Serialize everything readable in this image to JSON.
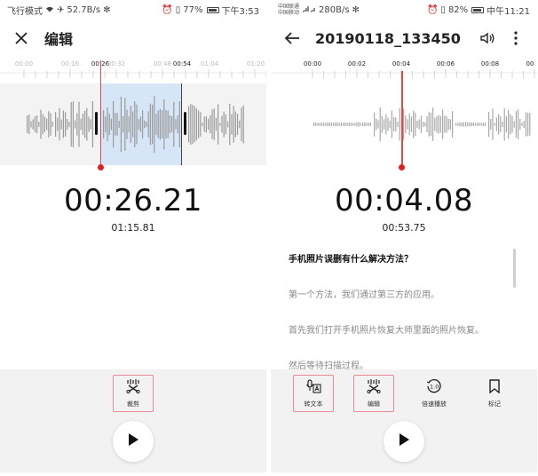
{
  "left": {
    "status": {
      "left_text": "飞行模式",
      "speed": "52.7B/s",
      "battery": "77%",
      "time": "下午3:53"
    },
    "header": {
      "title": "编辑"
    },
    "ruler": {
      "labels": [
        "00:00",
        "00:16",
        "00:26",
        "00:32",
        "00:48",
        "00:54",
        "01:04",
        "01:20"
      ],
      "highlighted": [
        "00:26",
        "00:54"
      ]
    },
    "time_main": "00:26.21",
    "time_sub": "01:15.81",
    "tools": [
      {
        "label": "裁剪",
        "icon": "scissors-waveform-icon"
      }
    ],
    "accent": "#e02020",
    "selection_color": "#d6e6f7"
  },
  "right": {
    "status": {
      "carrier1": "中国联通",
      "carrier2": "中国移动",
      "speed": "280B/s",
      "battery": "82%",
      "time": "中午11:21"
    },
    "header": {
      "title": "20190118_133450"
    },
    "ruler": {
      "labels": [
        "00:00",
        "00:02",
        "00:04",
        "00:06",
        "00:08",
        "00"
      ]
    },
    "time_main": "00:04.08",
    "time_sub": "00:53.75",
    "transcript": [
      "手机照片误删有什么解决方法？",
      "第一个方法，我们通过第三方的应用。",
      "首先我们打开手机照片恢复大师里面的照片恢复。",
      "然后等待扫描过程。"
    ],
    "tools": [
      {
        "label": "转文本",
        "icon": "speech-to-text-icon"
      },
      {
        "label": "编辑",
        "icon": "scissors-waveform-icon"
      },
      {
        "label": "倍速播放",
        "icon": "playback-speed-icon",
        "badge": "1.0"
      },
      {
        "label": "标记",
        "icon": "bookmark-icon"
      }
    ]
  }
}
